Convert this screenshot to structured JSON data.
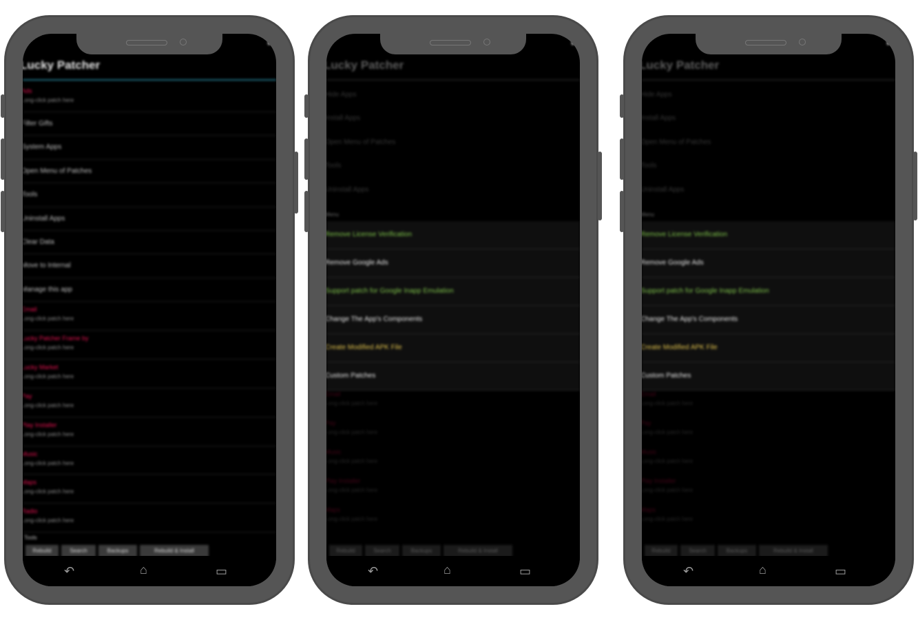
{
  "app_title": "Lucky Patcher",
  "phone1": {
    "items": [
      {
        "type": "app",
        "name": "Ads",
        "sub": "Long-click patch here"
      },
      {
        "type": "simple",
        "label": "Filter Gifts"
      },
      {
        "type": "simple",
        "label": "System Apps"
      },
      {
        "type": "simple",
        "label": "Open Menu of Patches"
      },
      {
        "type": "simple",
        "label": "Tools"
      },
      {
        "type": "simple",
        "label": "Uninstall Apps"
      },
      {
        "type": "simple",
        "label": "Clear Data"
      },
      {
        "type": "simple",
        "label": "Move to Internal"
      },
      {
        "type": "simple",
        "label": "Manage this app"
      },
      {
        "type": "app",
        "name": "Email",
        "sub": "Long-click patch here"
      },
      {
        "type": "app",
        "name": "Lucky Patcher Frame by",
        "sub": "Long-click patch here"
      },
      {
        "type": "app",
        "name": "Lucky Market",
        "sub": "Long-click patch here"
      },
      {
        "type": "app",
        "name": "Pay",
        "sub": "Long-click patch here"
      },
      {
        "type": "app",
        "name": "Play Installer",
        "sub": "Long-click patch here"
      },
      {
        "type": "app",
        "name": "Music",
        "sub": "Long-click patch here"
      },
      {
        "type": "app",
        "name": "Maps",
        "sub": "Long-click patch here"
      },
      {
        "type": "app",
        "name": "Radio",
        "sub": "Long-click patch here"
      }
    ],
    "bottom_label": "Tools",
    "bottom_buttons": [
      "Rebuild",
      "Search",
      "Backups",
      "Rebuild & Install"
    ]
  },
  "phone2": {
    "bg_items": [
      "Hide Apps",
      "Install Apps",
      "Open Menu of Patches",
      "Tools",
      "Uninstall Apps"
    ],
    "menu_header": "Menu",
    "menu_items": [
      {
        "label": "Remove License Verification",
        "color": "#7ec24a"
      },
      {
        "label": "Remove Google Ads",
        "color": "#e8e8e8"
      },
      {
        "label": "Support patch for Google Inapp Emulation",
        "color": "#7ec24a"
      },
      {
        "label": "Change The App's Components",
        "color": "#e8e8e8"
      },
      {
        "label": "Create Modified APK File",
        "color": "#e0c24e"
      },
      {
        "label": "Custom Patches",
        "color": "#e8e8e8"
      }
    ],
    "bg_apps": [
      {
        "name": "Email",
        "sub": "Long-click patch here"
      },
      {
        "name": "Pay",
        "sub": "Long-click patch here"
      },
      {
        "name": "Music",
        "sub": "Long-click patch here"
      },
      {
        "name": "Play Installer",
        "sub": "Long-click patch here"
      },
      {
        "name": "Maps",
        "sub": "Long-click patch here"
      }
    ],
    "bottom_buttons": [
      "Rebuild",
      "Search",
      "Backups",
      "Rebuild & Install"
    ]
  },
  "phone3": {
    "bg_items": [
      "Hide Apps",
      "Install Apps",
      "Open Menu of Patches",
      "Tools",
      "Uninstall Apps"
    ],
    "menu_header": "Menu",
    "menu_items": [
      {
        "label": "Remove License Verification",
        "color": "#7ec24a"
      },
      {
        "label": "Remove Google Ads",
        "color": "#e8e8e8"
      },
      {
        "label": "Support patch for Google Inapp Emulation",
        "color": "#7ec24a"
      },
      {
        "label": "Change The App's Components",
        "color": "#e8e8e8"
      },
      {
        "label": "Create Modified APK File",
        "color": "#e0c24e"
      },
      {
        "label": "Custom Patches",
        "color": "#e8e8e8"
      }
    ],
    "bg_apps": [
      {
        "name": "Email",
        "sub": "Long-click patch here"
      },
      {
        "name": "Pay",
        "sub": "Long-click patch here"
      },
      {
        "name": "Music",
        "sub": "Long-click patch here"
      },
      {
        "name": "Play Installer",
        "sub": "Long-click patch here"
      },
      {
        "name": "Maps",
        "sub": "Long-click patch here"
      }
    ],
    "bottom_buttons": [
      "Rebuild",
      "Search",
      "Backups",
      "Rebuild & Install"
    ]
  },
  "nav_icons": [
    "back-icon",
    "home-icon",
    "recents-icon"
  ],
  "colors": {
    "app_name": "#e0114e",
    "accent_rule": "#1e6e82",
    "green": "#7ec24a",
    "yellow": "#e0c24e"
  }
}
